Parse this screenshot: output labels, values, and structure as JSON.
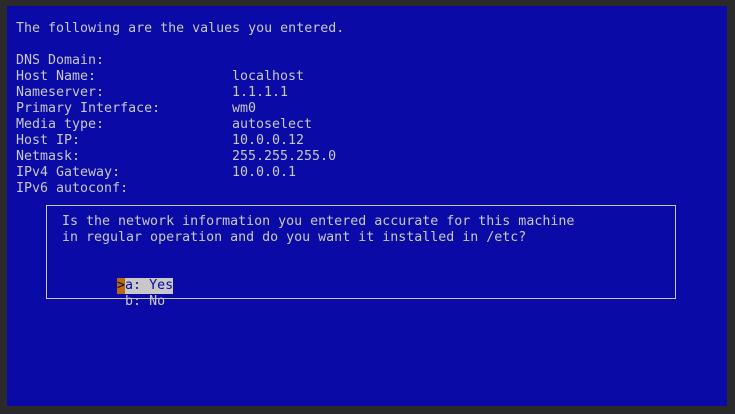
{
  "heading": "The following are the values you entered.",
  "fields": [
    {
      "label": "DNS Domain:",
      "value": ""
    },
    {
      "label": "Host Name:",
      "value": "localhost"
    },
    {
      "label": "Nameserver:",
      "value": "1.1.1.1"
    },
    {
      "label": "Primary Interface:",
      "value": "wm0"
    },
    {
      "label": "Media type:",
      "value": "autoselect"
    },
    {
      "label": "Host IP:",
      "value": "10.0.0.12"
    },
    {
      "label": "Netmask:",
      "value": "255.255.255.0"
    },
    {
      "label": "IPv4 Gateway:",
      "value": "10.0.0.1"
    },
    {
      "label": "IPv6 autoconf:",
      "value": ""
    }
  ],
  "dialog": {
    "line1": "Is the network information you entered accurate for this machine",
    "line2": "in regular operation and do you want it installed in /etc?",
    "cursor_glyph": ">",
    "options": [
      {
        "label": "a: Yes",
        "selected": true
      },
      {
        "label": "b: No",
        "selected": false
      }
    ]
  },
  "colors": {
    "background": "#0a0aa6",
    "text": "#c8c8c8",
    "cursor": "#b86a12"
  }
}
